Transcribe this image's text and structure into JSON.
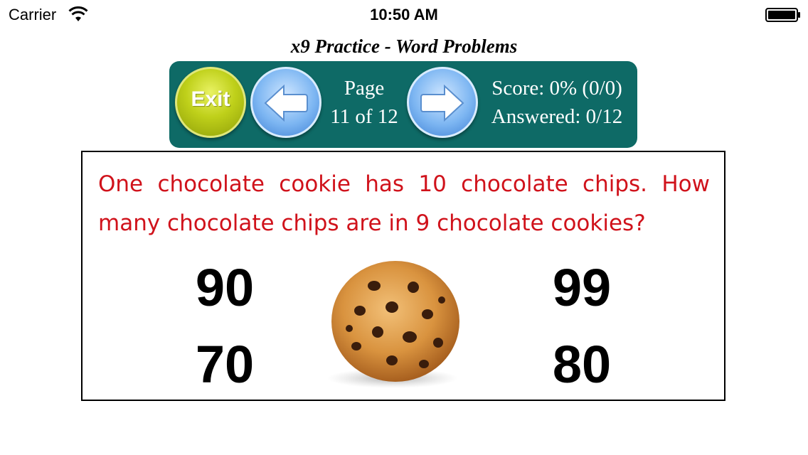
{
  "status_bar": {
    "carrier": "Carrier",
    "time": "10:50 AM",
    "wifi_icon": "wifi-icon",
    "battery_icon": "battery-icon"
  },
  "title": "x9 Practice - Word Problems",
  "toolbar": {
    "exit_label": "Exit",
    "prev_icon": "arrow-left-icon",
    "next_icon": "arrow-right-icon",
    "page_label": "Page",
    "page_value": "11 of 12",
    "score": "Score: 0% (0/0)",
    "answered": "Answered: 0/12",
    "colors": {
      "background": "#0e6a66",
      "exit": "#bfd01a",
      "nav": "#7db6f2"
    }
  },
  "question": {
    "text": "One chocolate cookie has 10 chocolate chips. How many chocolate chips are in 9 chocolate cookies?",
    "color": "#d0121b",
    "image": "chocolate-chip-cookie",
    "answers": [
      "90",
      "99",
      "70",
      "80"
    ]
  }
}
